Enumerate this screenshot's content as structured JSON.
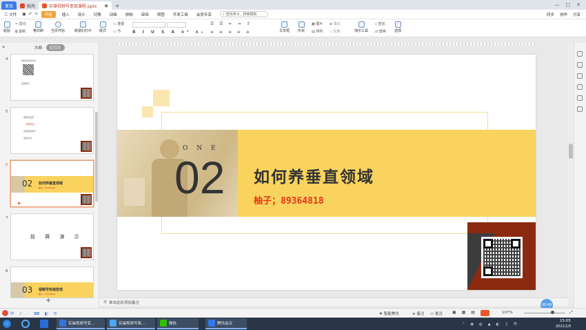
{
  "titlebar": {
    "home_tab": "首页",
    "tabs": [
      "稻壳",
      "实操视频号变现课程.pptx"
    ],
    "new_tab": "+",
    "window_controls": [
      "—",
      "□",
      "✕"
    ]
  },
  "menubar": {
    "file": "三 文件",
    "items": [
      "开始",
      "插入",
      "设计",
      "切换",
      "动画",
      "放映",
      "审阅",
      "视图",
      "开发工具",
      "会员专享"
    ],
    "search_placeholder": "查找命令、搜索模板",
    "right": [
      "同步",
      "协作",
      "分享"
    ]
  },
  "ribbon": {
    "paste": "粘贴",
    "cut": "剪切",
    "copy": "复制",
    "format_painter": "格式刷",
    "from_current": "当页开始",
    "new_slide": "新建幻灯片",
    "layout": "版式",
    "section": "节",
    "reset": "重置",
    "textbox": "文本框",
    "shapes": "形状",
    "arrange": "排列",
    "picture": "图片",
    "fill": "填充",
    "outline": "轮廓",
    "presentation_tools": "演示工具",
    "find": "查找",
    "replace": "替换",
    "select": "选择"
  },
  "left_panel": {
    "tabs": [
      "大纲",
      "幻灯片"
    ],
    "slides": [
      {
        "num": "4",
        "lines": [
          "视频号运营方法",
          "",
          "运营技巧"
        ]
      },
      {
        "num": "5",
        "lines": [
          "视频号运营",
          "账号定位",
          "内容运营技巧",
          "运营方法"
        ]
      },
      {
        "num": "6",
        "big": "02",
        "title": "如何养垂直领域",
        "sub": "柚子；89364818"
      },
      {
        "num": "7",
        "title": "投 屏 演 示"
      },
      {
        "num": "8",
        "big": "03",
        "title": "视频号快速变现",
        "sub": "柚子；89364818"
      }
    ],
    "add": "+"
  },
  "slide": {
    "number": "02",
    "one": "O N E",
    "title": "如何养垂直领域",
    "subtitle": "柚子；89364818",
    "accent": "#f9d35e",
    "subtitle_color": "#e8331a",
    "qr_bg": "#8b2a10"
  },
  "notes": {
    "placeholder": "单击此处添加备注"
  },
  "statusbar": {
    "smart_beautify": "智能美化",
    "notes": "备注",
    "comments": "批注",
    "zoom": "107%"
  },
  "taskbar": {
    "apps": [
      "实操视频号变...",
      "实操视频号简...",
      "微信",
      "腾讯会议"
    ],
    "time": "15:05",
    "date": "2021/1/5"
  },
  "timer": "00:49"
}
